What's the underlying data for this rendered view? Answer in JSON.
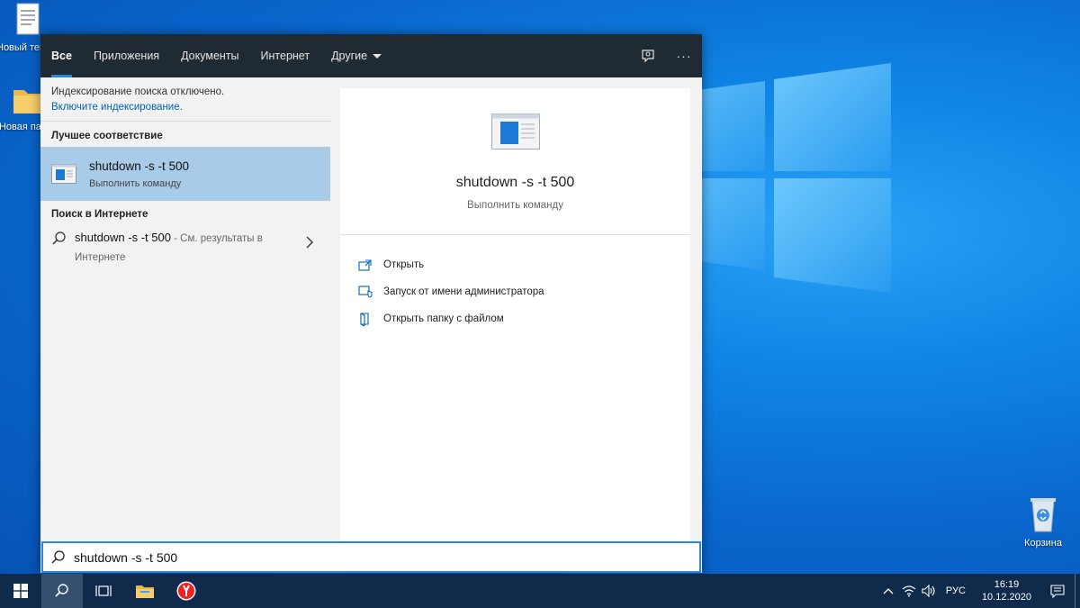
{
  "desktop": {
    "icons": [
      {
        "label": "Новый текстов",
        "icon": "text-document-icon"
      },
      {
        "label": "Новая папка",
        "icon": "folder-icon"
      },
      {
        "label": "Корзина",
        "icon": "recycle-bin-icon"
      }
    ]
  },
  "search_panel": {
    "tabs": [
      {
        "label": "Все",
        "active": true
      },
      {
        "label": "Приложения"
      },
      {
        "label": "Документы"
      },
      {
        "label": "Интернет"
      },
      {
        "label": "Другие",
        "has_dropdown": true
      }
    ],
    "header_actions": [
      {
        "icon": "feedback-icon"
      },
      {
        "icon": "more-options-icon",
        "label": "···"
      }
    ],
    "indexing_notice": {
      "message": "Индексирование поиска отключено.",
      "link": "Включите индексирование."
    },
    "best_match": {
      "section_title": "Лучшее соответствие",
      "title": "shutdown -s -t 500",
      "subtitle": "Выполнить команду",
      "icon": "run-command-icon"
    },
    "web_search": {
      "section_title": "Поиск в Интернете",
      "query": "shutdown -s -t 500",
      "suffix": " - См. результаты в Интернете"
    },
    "detail": {
      "title": "shutdown -s -t 500",
      "subtitle": "Выполнить команду",
      "actions": [
        {
          "label": "Открыть",
          "icon": "open-icon"
        },
        {
          "label": "Запуск от имени администратора",
          "icon": "run-as-admin-icon"
        },
        {
          "label": "Открыть папку с файлом",
          "icon": "open-file-location-icon"
        }
      ]
    },
    "search_box": {
      "value": "shutdown -s -t 500"
    }
  },
  "taskbar": {
    "buttons": [
      {
        "icon": "windows-start-icon"
      },
      {
        "icon": "search-icon",
        "active": true
      },
      {
        "icon": "task-view-icon"
      },
      {
        "icon": "file-explorer-icon"
      },
      {
        "icon": "yandex-browser-icon"
      }
    ],
    "tray": {
      "language": "РУС",
      "time": "16:19",
      "date": "10.12.2020"
    }
  },
  "colors": {
    "accent": "#2b88d8",
    "tabbar_bg": "#202a33",
    "selected_item": "#a8cbe8",
    "taskbar_bg": "#0f2a4a",
    "link": "#0063b1"
  }
}
